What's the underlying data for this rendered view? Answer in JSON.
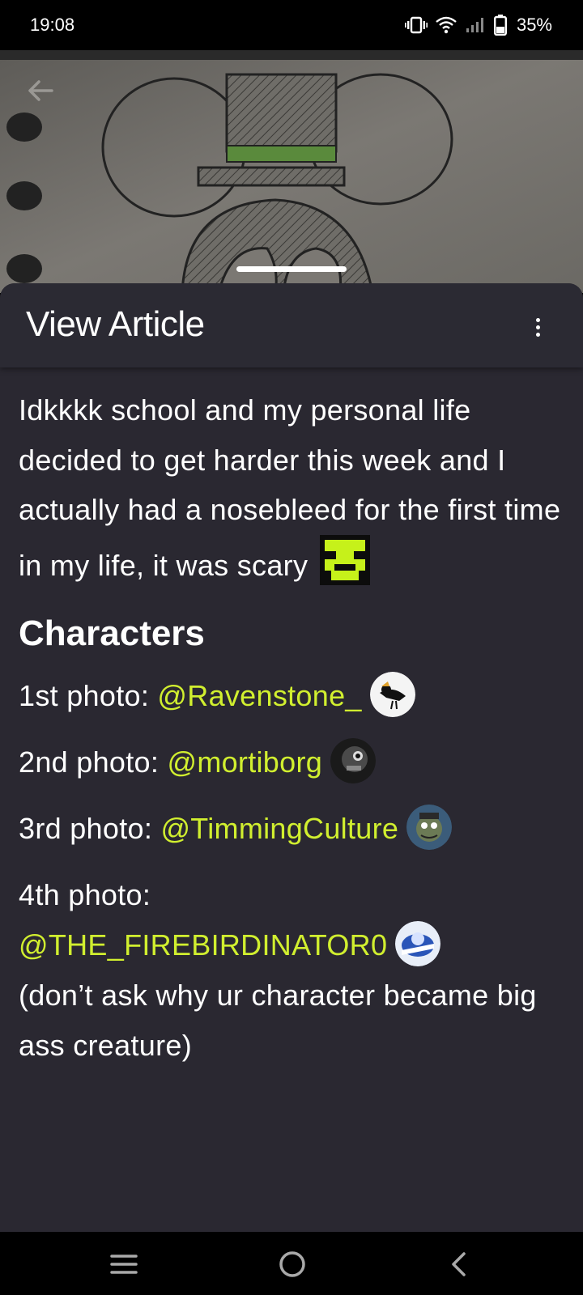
{
  "status": {
    "time": "19:08",
    "battery": "35%"
  },
  "header": {
    "title": "View Article"
  },
  "article": {
    "body": "Idkkkk school and my personal life decided to get harder this week and I actually had a nosebleed for the first time in my life, it was scary",
    "characters_heading": "Characters",
    "characters": [
      {
        "prefix": "1st photo: ",
        "mention": "@Ravenstone_"
      },
      {
        "prefix": "2nd photo: ",
        "mention": "@mortiborg"
      },
      {
        "prefix": "3rd photo: ",
        "mention": "@TimmingCulture"
      },
      {
        "prefix": "4th photo:",
        "mention": "@THE_FIREBIRDINATOR0",
        "note": "(don’t ask why ur character became big ass creature)"
      }
    ]
  },
  "colors": {
    "mention": "#d1ef2f",
    "sheet_bg": "#2a2831",
    "emoji": "#c6f11a"
  }
}
